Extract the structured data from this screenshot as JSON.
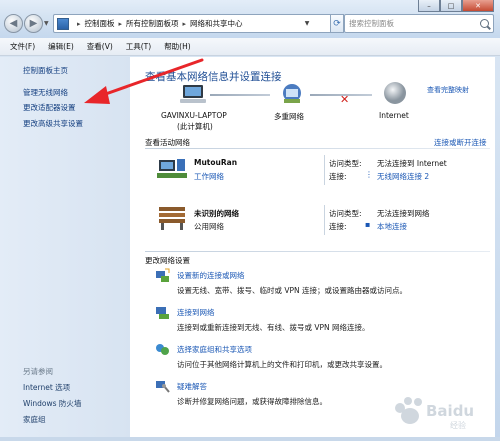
{
  "address_bar": {
    "crumbs": [
      "控制面板",
      "所有控制面板项",
      "网络和共享中心"
    ],
    "search_placeholder": "搜索控制面板"
  },
  "menu": [
    "文件(F)",
    "编辑(E)",
    "查看(V)",
    "工具(T)",
    "帮助(H)"
  ],
  "sidebar": {
    "home": "控制面板主页",
    "items": [
      "管理无线网络",
      "更改适配器设置",
      "更改高级共享设置"
    ],
    "see_also_title": "另请参阅",
    "see_also": [
      "Internet 选项",
      "Windows 防火墙",
      "家庭组"
    ]
  },
  "main": {
    "title": "查看基本网络信息并设置连接",
    "full_map": "查看完整映射",
    "map": {
      "computer_name": "GAVINXU-LAPTOP",
      "computer_sub": "(此计算机)",
      "network_label": "多重网络",
      "internet_label": "Internet"
    },
    "active_header": "查看活动网络",
    "connect_link": "连接或断开连接",
    "networks": [
      {
        "name": "MutouRan",
        "type": "工作网络",
        "access_label": "访问类型:",
        "access_value": "无法连接到 Internet",
        "conn_label": "连接:",
        "conn_value": "无线网络连接 2"
      },
      {
        "name": "未识别的网络",
        "type": "公用网络",
        "access_label": "访问类型:",
        "access_value": "无法连接到网络",
        "conn_label": "连接:",
        "conn_value": "本地连接"
      }
    ],
    "settings_header": "更改网络设置",
    "tasks": [
      {
        "link": "设置新的连接或网络",
        "desc": "设置无线、宽带、拨号、临时或 VPN 连接；或设置路由器或访问点。"
      },
      {
        "link": "连接到网络",
        "desc": "连接到或重新连接到无线、有线、拨号或 VPN 网络连接。"
      },
      {
        "link": "选择家庭组和共享选项",
        "desc": "访问位于其他网络计算机上的文件和打印机，或更改共享设置。"
      },
      {
        "link": "疑难解答",
        "desc": "诊断并修复网络问题，或获得故障排除信息。"
      }
    ]
  },
  "watermark": "Baidu 经验",
  "colors": {
    "link": "#1a57b4",
    "title": "#1e4d94",
    "annotation_arrow": "#e8262a"
  }
}
